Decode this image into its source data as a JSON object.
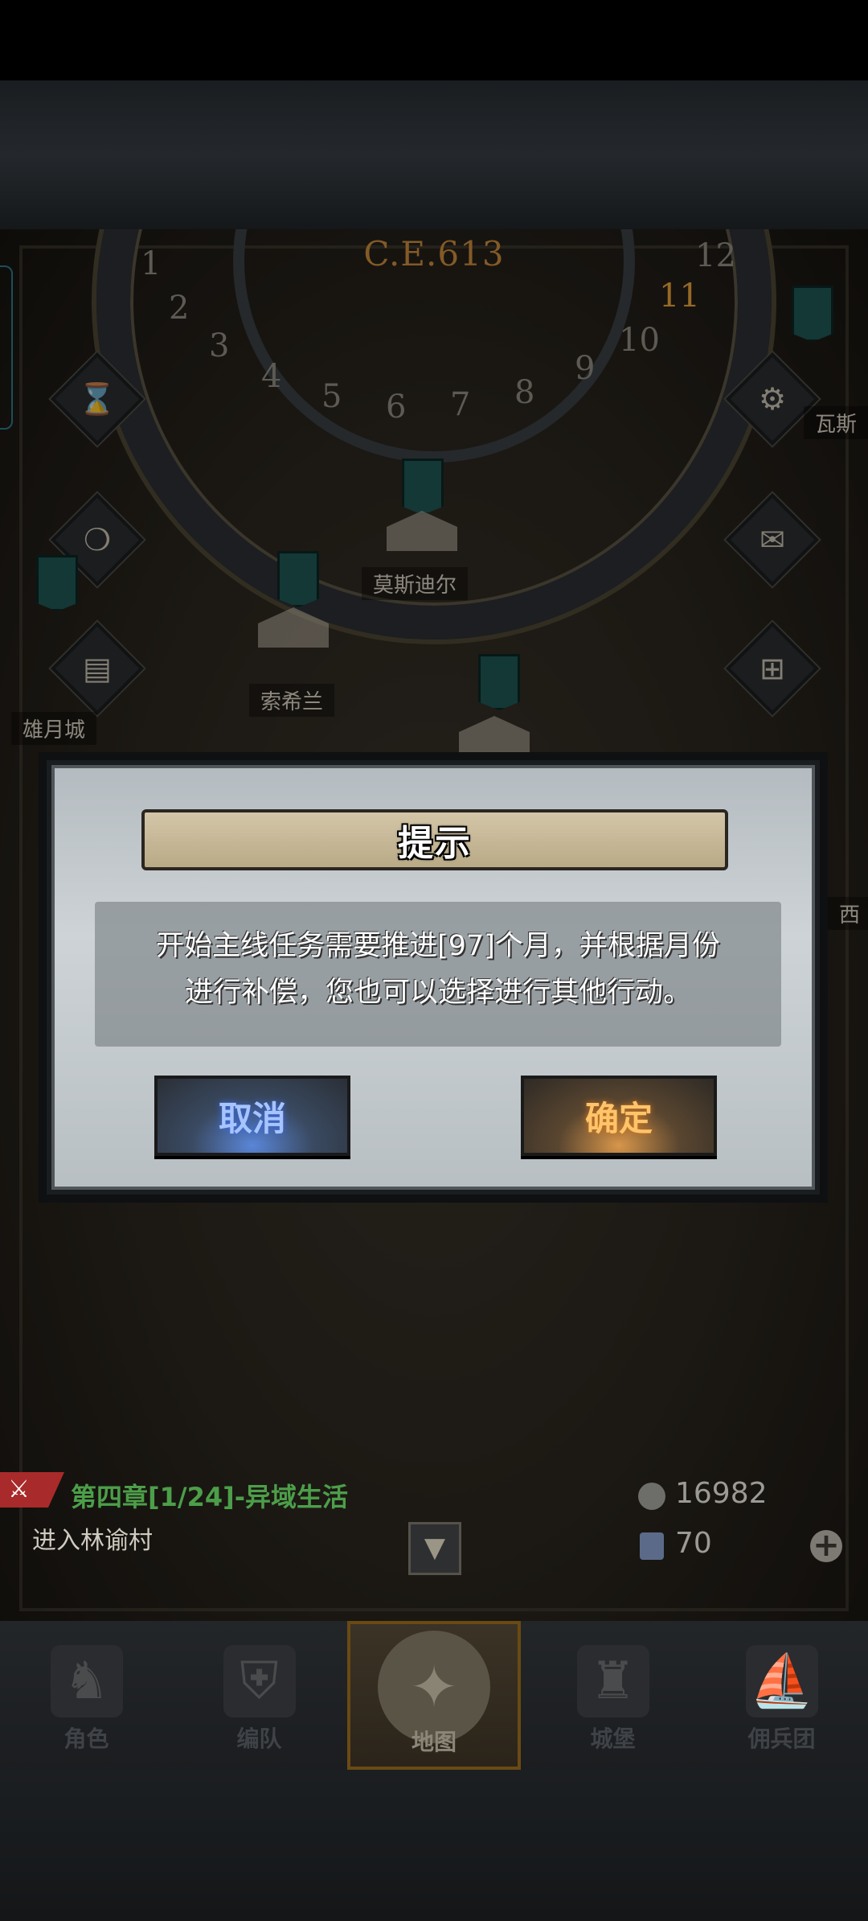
{
  "calendar": {
    "era": "C.E.613",
    "months": [
      "1",
      "2",
      "3",
      "4",
      "5",
      "6",
      "7",
      "8",
      "9",
      "10",
      "11",
      "12"
    ],
    "current_month": "11"
  },
  "map": {
    "locations": [
      "莫斯迪尔",
      "索希兰",
      "雄月城",
      "瓦斯",
      "西"
    ]
  },
  "quest": {
    "title": "第四章[1/24]-异域生活",
    "subtitle": "进入林谕村"
  },
  "resources": {
    "coins": "16982",
    "gems": "70"
  },
  "dialog": {
    "title": "提示",
    "message_line1": "开始主线任务需要推进[97]个月，并根据月份",
    "message_line2": "进行补偿，您也可以选择进行其他行动。",
    "cancel_label": "取消",
    "confirm_label": "确定"
  },
  "nav": {
    "items": [
      {
        "label": "角色",
        "icon": "knight-icon"
      },
      {
        "label": "编队",
        "icon": "helmet-icon"
      },
      {
        "label": "地图",
        "icon": "compass-map-icon"
      },
      {
        "label": "城堡",
        "icon": "castle-icon"
      },
      {
        "label": "佣兵团",
        "icon": "ship-icon"
      }
    ],
    "active": "地图"
  },
  "colors": {
    "quest_green": "#4c9e49",
    "cancel_blue": "#a7c4ff",
    "confirm_orange": "#ffc46a",
    "month_highlight": "#e6a13a"
  }
}
